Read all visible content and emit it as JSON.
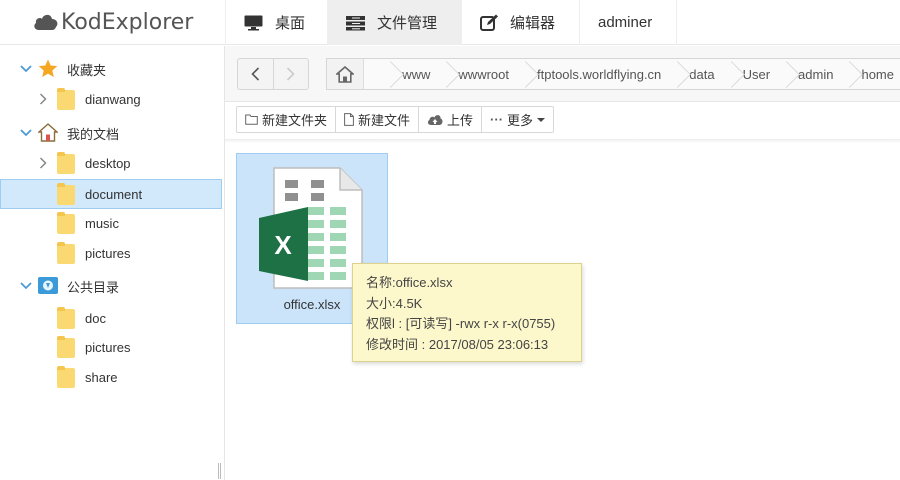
{
  "app": {
    "title": "KodExplorer",
    "brand_color": "#555555"
  },
  "nav": {
    "tabs": [
      {
        "label": "桌面",
        "icon": "desktop-icon"
      },
      {
        "label": "文件管理",
        "icon": "file-manager-icon",
        "active": true
      },
      {
        "label": "编辑器",
        "icon": "editor-icon"
      },
      {
        "label": "adminer"
      }
    ]
  },
  "sidebar": {
    "favorites": {
      "label": "收藏夹",
      "icon": "star-icon",
      "items": [
        {
          "label": "dianwang"
        }
      ]
    },
    "my_docs": {
      "label": "我的文档",
      "icon": "home-icon",
      "items": [
        {
          "label": "desktop"
        },
        {
          "label": "document",
          "selected": true
        },
        {
          "label": "music"
        },
        {
          "label": "pictures"
        }
      ]
    },
    "public": {
      "label": "公共目录",
      "icon": "public-folder-icon",
      "items": [
        {
          "label": "doc"
        },
        {
          "label": "pictures"
        },
        {
          "label": "share"
        }
      ]
    }
  },
  "breadcrumb": [
    "www",
    "wwwroot",
    "ftptools.worldflying.cn",
    "data",
    "User",
    "admin",
    "home"
  ],
  "toolbar": {
    "new_folder": "新建文件夹",
    "new_file": "新建文件",
    "upload": "上传",
    "more": "更多"
  },
  "files": [
    {
      "name": "office.xlsx",
      "icon": "excel-file-icon"
    }
  ],
  "tooltip": {
    "name": "名称:office.xlsx",
    "size": "大小:4.5K",
    "perm": "权限l : [可读写] -rwx r-x r-x(0755)",
    "mtime": "修改时间 : 2017/08/05 23:06:13"
  },
  "colors": {
    "selection": "#cbe4fa",
    "folder": "#fbd972",
    "excel_green": "#1e7145",
    "tooltip_bg": "#fcf8cc"
  }
}
